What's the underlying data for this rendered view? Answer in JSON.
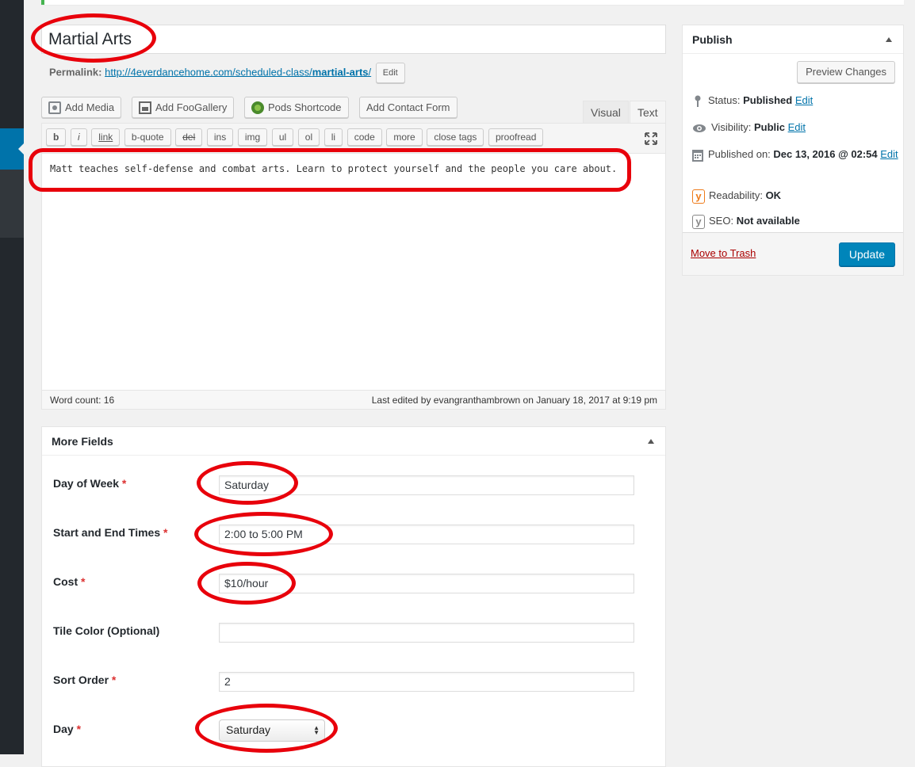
{
  "post": {
    "title": "Martial Arts",
    "permalink_label": "Permalink:",
    "permalink_base": "http://4everdancehome.com/scheduled-class/",
    "permalink_slug": "martial-arts",
    "permalink_trailing": "/",
    "permalink_edit": "Edit"
  },
  "media_buttons": {
    "add_media": "Add Media",
    "add_foogallery": "Add FooGallery",
    "pods_shortcode": "Pods Shortcode",
    "add_contact_form": "Add Contact Form"
  },
  "editor_tabs": {
    "visual": "Visual",
    "text": "Text"
  },
  "quicktags": [
    "b",
    "i",
    "link",
    "b-quote",
    "del",
    "ins",
    "img",
    "ul",
    "ol",
    "li",
    "code",
    "more",
    "close tags",
    "proofread"
  ],
  "editor": {
    "content": "Matt teaches self-defense and combat arts. Learn to protect yourself and the people you care about.",
    "word_count": "Word count: 16",
    "last_edited": "Last edited by evangranthambrown on January 18, 2017 at 9:19 pm"
  },
  "more_fields": {
    "title": "More Fields",
    "required_mark": "*",
    "day_of_week": {
      "label": "Day of Week",
      "value": "Saturday"
    },
    "times": {
      "label": "Start and End Times",
      "value": "2:00 to 5:00 PM"
    },
    "cost": {
      "label": "Cost",
      "value": "$10/hour"
    },
    "tile_color": {
      "label": "Tile Color (Optional)",
      "value": ""
    },
    "sort_order": {
      "label": "Sort Order",
      "value": "2"
    },
    "day": {
      "label": "Day",
      "value": "Saturday"
    }
  },
  "publish": {
    "title": "Publish",
    "preview": "Preview Changes",
    "status_label": "Status:",
    "status_value": "Published",
    "visibility_label": "Visibility:",
    "visibility_value": "Public",
    "published_label": "Published on:",
    "published_value": "Dec 13, 2016 @ 02:54",
    "edit": "Edit",
    "readability_label": "Readability:",
    "readability_value": "OK",
    "seo_label": "SEO:",
    "seo_value": "Not available",
    "trash": "Move to Trash",
    "update": "Update"
  },
  "colors": {
    "accent": "#0073aa",
    "update_button": "#0085ba",
    "annotation_red": "#e8000b",
    "required_red": "#dc3232",
    "yoast_readability": "#ee7c1b",
    "yoast_seo": "#888888"
  }
}
